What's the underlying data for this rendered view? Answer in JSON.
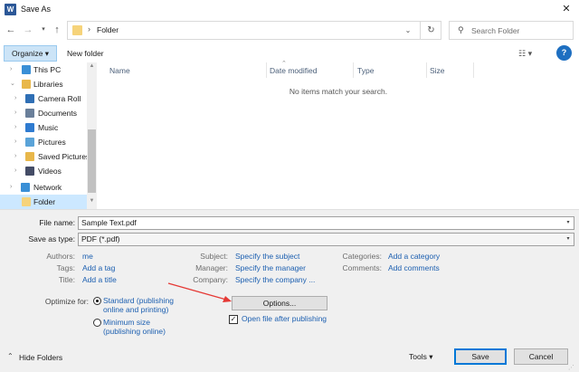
{
  "window": {
    "title": "Save As",
    "app_icon_letter": "W"
  },
  "address": {
    "path": "Folder",
    "separator": "›"
  },
  "search": {
    "placeholder": "Search Folder"
  },
  "toolbar": {
    "organize": "Organize ▾",
    "new_folder": "New folder",
    "view": "☷ ▾",
    "help": "?"
  },
  "nav": {
    "items": [
      {
        "label": "This PC",
        "icon_color": "#3a8fd6"
      },
      {
        "label": "Libraries",
        "icon_color": "#e8b74a"
      },
      {
        "label": "Camera Roll",
        "icon_color": "#2f6fb5"
      },
      {
        "label": "Documents",
        "icon_color": "#6a7f9a"
      },
      {
        "label": "Music",
        "icon_color": "#2f7bd0"
      },
      {
        "label": "Pictures",
        "icon_color": "#5aa3d8"
      },
      {
        "label": "Saved Pictures",
        "icon_color": "#e8b74a"
      },
      {
        "label": "Videos",
        "icon_color": "#444c66"
      },
      {
        "label": "Network",
        "icon_color": "#3a8fd6"
      },
      {
        "label": "Folder",
        "icon_color": "#f6d37a"
      }
    ]
  },
  "file_list": {
    "columns": [
      "Name",
      "Date modified",
      "Type",
      "Size"
    ],
    "empty_message": "No items match your search."
  },
  "form": {
    "file_name_label": "File name:",
    "file_name_value": "Sample Text.pdf",
    "save_type_label": "Save as type:",
    "save_type_value": "PDF (*.pdf)"
  },
  "meta": {
    "authors_label": "Authors:",
    "authors_value": "me",
    "tags_label": "Tags:",
    "tags_value": "Add a tag",
    "title_label": "Title:",
    "title_value": "Add a title",
    "subject_label": "Subject:",
    "subject_value": "Specify the subject",
    "manager_label": "Manager:",
    "manager_value": "Specify the manager",
    "company_label": "Company:",
    "company_value": "Specify the company ...",
    "categories_label": "Categories:",
    "categories_value": "Add a category",
    "comments_label": "Comments:",
    "comments_value": "Add comments"
  },
  "optimize": {
    "label": "Optimize for:",
    "standard_line1": "Standard (publishing",
    "standard_line2": "online and printing)",
    "minimum_line1": "Minimum size",
    "minimum_line2": "(publishing online)",
    "selected": "standard"
  },
  "options_button": "Options...",
  "open_after": {
    "label": "Open file after publishing",
    "checked": true
  },
  "footer": {
    "hide_folders": "Hide Folders",
    "tools": "Tools ▾",
    "save": "Save",
    "cancel": "Cancel"
  },
  "colors": {
    "accent": "#0078d7",
    "link": "#1c5fb0",
    "annotation_arrow": "#e53935"
  }
}
